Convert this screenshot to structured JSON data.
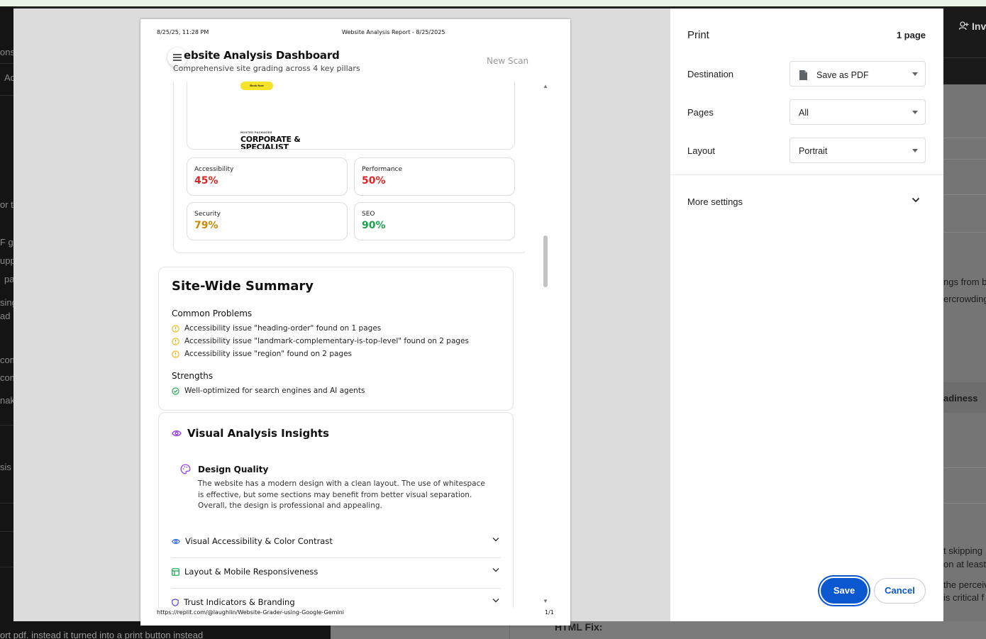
{
  "background": {
    "left_fragments": [
      "onso",
      "Ad",
      "or th",
      "F g",
      "upp",
      "pa",
      "sing",
      "ad",
      "com",
      "com",
      "nak",
      "sis n"
    ],
    "right_top_label": "Inv",
    "right_fragments": [
      "ngs from b",
      "ercrowding",
      "adiness",
      "t skipping",
      "on at least",
      "the perceiv",
      "is critical f"
    ],
    "bottom_left_text": "ort pdf. instead it turned into a print button instead",
    "bottom_mid_text": "HTML Fix:"
  },
  "paper": {
    "header_left": "8/25/25, 11:28 PM",
    "header_center": "Website Analysis Report - 8/25/2025",
    "app_title": "ebsite Analysis Dashboard",
    "app_subtitle": "Comprehensive site grading across 4 key pillars",
    "new_scan": "New Scan",
    "screenshot": {
      "button_text": "Book Now",
      "tiny_label": "HOSTED PACKAGES",
      "headline": "CORPORATE &\nSPECIALIST"
    },
    "scores": [
      {
        "label": "Accessibility",
        "value": "45%",
        "color": "#dc2626"
      },
      {
        "label": "Performance",
        "value": "50%",
        "color": "#dc2626"
      },
      {
        "label": "Security",
        "value": "79%",
        "color": "#ca8a04"
      },
      {
        "label": "SEO",
        "value": "90%",
        "color": "#16a34a"
      }
    ],
    "summary": {
      "title": "Site-Wide Summary",
      "problems_heading": "Common Problems",
      "problems": [
        "Accessibility issue \"heading-order\" found on 1 pages",
        "Accessibility issue \"landmark-complementary-is-top-level\" found on 2 pages",
        "Accessibility issue \"region\" found on 2 pages"
      ],
      "strengths_heading": "Strengths",
      "strengths": [
        "Well-optimized for search engines and AI agents"
      ]
    },
    "visual": {
      "title": "Visual Analysis Insights",
      "design_title": "Design Quality",
      "design_text": "The website has a modern design with a clean layout. The use of whitespace is effective, but some sections may benefit from better visual separation. Overall, the design is professional and appealing.",
      "sections": [
        {
          "label": "Visual Accessibility & Color Contrast",
          "icon": "eye-icon"
        },
        {
          "label": "Layout & Mobile Responsiveness",
          "icon": "layout-icon"
        },
        {
          "label": "Trust Indicators & Branding",
          "icon": "shield-icon"
        }
      ]
    },
    "footer_url": "https://replit.com/@laughlin/Website-Grader-using-Google-Gemini",
    "footer_page": "1/1"
  },
  "print_settings": {
    "title": "Print",
    "page_count": "1 page",
    "destination_label": "Destination",
    "destination_value": "Save as PDF",
    "pages_label": "Pages",
    "pages_value": "All",
    "layout_label": "Layout",
    "layout_value": "Portrait",
    "more_settings": "More settings",
    "save_button": "Save",
    "cancel_button": "Cancel"
  }
}
